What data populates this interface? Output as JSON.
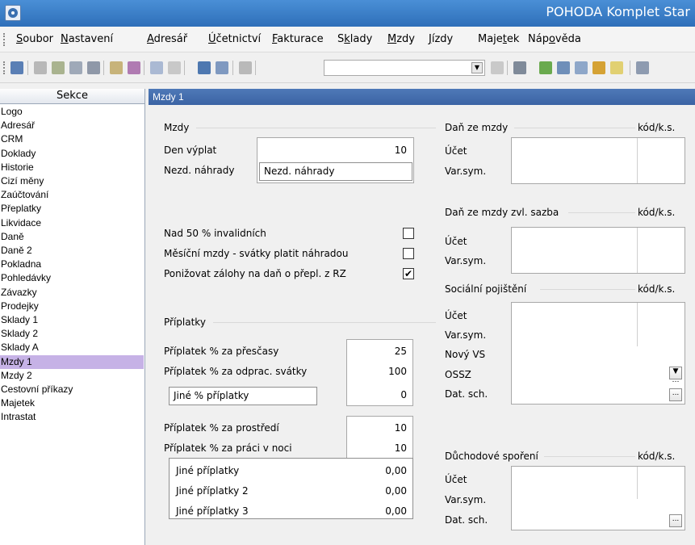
{
  "window": {
    "title": "POHODA Komplet Star"
  },
  "menu": {
    "items": [
      {
        "pre": "",
        "u": "S",
        "post": "oubor"
      },
      {
        "pre": "",
        "u": "N",
        "post": "astavení"
      },
      {
        "pre": "",
        "u": "A",
        "post": "dresář"
      },
      {
        "pre": "",
        "u": "Ú",
        "post": "četnictví"
      },
      {
        "pre": "",
        "u": "F",
        "post": "akturace"
      },
      {
        "pre": "S",
        "u": "k",
        "post": "lady"
      },
      {
        "pre": "",
        "u": "M",
        "post": "zdy"
      },
      {
        "pre": "",
        "u": "J",
        "post": "ízdy"
      },
      {
        "pre": "Maje",
        "u": "t",
        "post": "ek"
      },
      {
        "pre": "Náp",
        "u": "o",
        "post": "věda"
      }
    ]
  },
  "sidebar": {
    "header": "Sekce",
    "items": [
      "Logo",
      "Adresář",
      "CRM",
      "Doklady",
      "Historie",
      "Cizí měny",
      "Zaúčtování",
      "Přeplatky",
      "Likvidace",
      "Daně",
      "Daně 2",
      "Pokladna",
      "Pohledávky",
      "Závazky",
      "Prodejky",
      "Sklady 1",
      "Sklady 2",
      "Sklady A",
      "Mzdy 1",
      "Mzdy 2",
      "Cestovní příkazy",
      "Majetek",
      "Intrastat"
    ],
    "selected": "Mzdy 1"
  },
  "panel": {
    "title": "Mzdy 1",
    "mzdy": {
      "heading": "Mzdy",
      "den_vyplat_label": "Den výplat",
      "den_vyplat_value": "10",
      "nezd_label": "Nezd. náhrady",
      "nezd_value": "Nezd. náhrady"
    },
    "checks": [
      {
        "label": "Nad 50 % invalidních",
        "checked": false
      },
      {
        "label": "Měsíční mzdy - svátky platit náhradou",
        "checked": false
      },
      {
        "label": "Ponižovat zálohy na daň o přepl. z RZ",
        "checked": true
      }
    ],
    "priplatky": {
      "heading": "Příplatky",
      "prescasy_label": "Příplatek % za přesčasy",
      "prescasy_value": "25",
      "svatky_label": "Příplatek % za odprac. svátky",
      "svatky_value": "100",
      "jine_pct_label": "Jiné % příplatky",
      "jine_pct_value": "0",
      "prostredi_label": "Příplatek % za prostředí",
      "prostredi_value": "10",
      "noc_label": "Příplatek % za práci v noci",
      "noc_value": "10",
      "jine": [
        {
          "label": "Jiné příplatky",
          "value": "0,00"
        },
        {
          "label": "Jiné příplatky 2",
          "value": "0,00"
        },
        {
          "label": "Jiné příplatky 3",
          "value": "0,00"
        }
      ]
    },
    "dan_mzdy": {
      "heading": "Daň ze mzdy",
      "kod": "kód/k.s.",
      "ucet": "Účet",
      "varsym": "Var.sym."
    },
    "dan_zvl": {
      "heading": "Daň ze mzdy zvl. sazba",
      "kod": "kód/k.s.",
      "ucet": "Účet",
      "varsym": "Var.sym."
    },
    "soc": {
      "heading": "Sociální pojištění",
      "kod": "kód/k.s.",
      "ucet": "Účet",
      "varsym": "Var.sym.",
      "novy_vs": "Nový VS",
      "ossz": "OSSZ",
      "dat_sch": "Dat. sch."
    },
    "duch": {
      "heading": "Důchodové spoření",
      "kod": "kód/k.s.",
      "ucet": "Účet",
      "varsym": "Var.sym.",
      "dat_sch": "Dat. sch."
    },
    "ellipsis": "..."
  }
}
